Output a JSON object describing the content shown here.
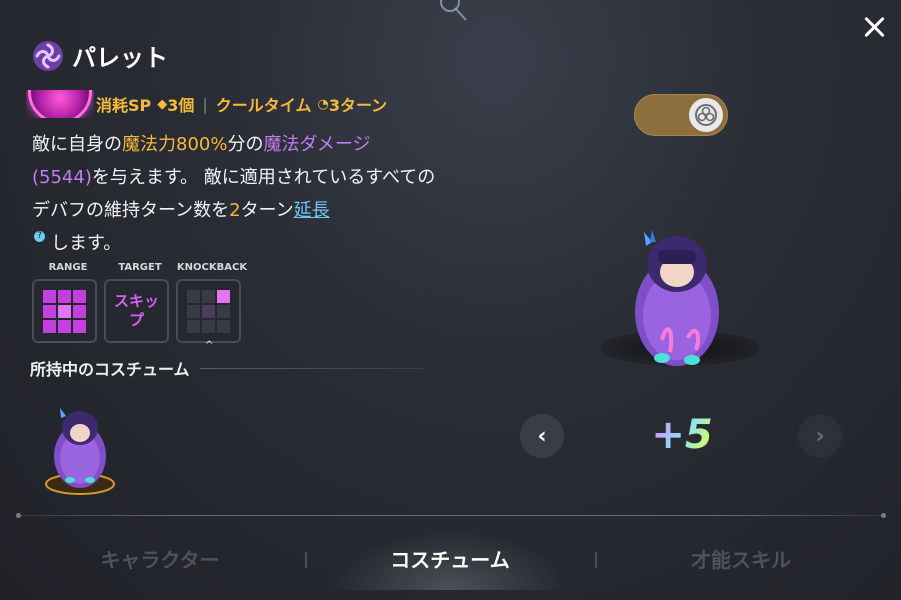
{
  "header": {
    "title": "パレット",
    "close_icon": "close-icon"
  },
  "skill": {
    "cost_label": "消耗SP",
    "cost_value": "3個",
    "cooldown_label": "クールタイム",
    "cooldown_value": "3ターン",
    "desc": {
      "p1": "敵に自身の",
      "p2": "魔法力800%",
      "p3": "分の",
      "p4": "魔法ダメージ",
      "p5": "(5544)",
      "p6": "を与えます。 敵に適用されているすべてのデバフの維持ターン数を",
      "p7": "2",
      "p8": "ターン",
      "p9": "延長",
      "p10": "します。"
    },
    "stats": {
      "range_label": "RANGE",
      "target_label": "TARGET",
      "target_value_line1": "スキッ",
      "target_value_line2": "プ",
      "knockback_label": "KNOCKBACK"
    }
  },
  "costume": {
    "owned_label": "所持中のコスチューム",
    "level": "+5"
  },
  "toggle": {
    "state": "on"
  },
  "tabs": {
    "character": "キャラクター",
    "costume": "コスチューム",
    "talent": "才能スキル",
    "active": "コスチューム"
  },
  "colors": {
    "accent_gold": "#f5b93b",
    "accent_purple": "#c47cf2",
    "link_blue": "#6fc8f0"
  }
}
